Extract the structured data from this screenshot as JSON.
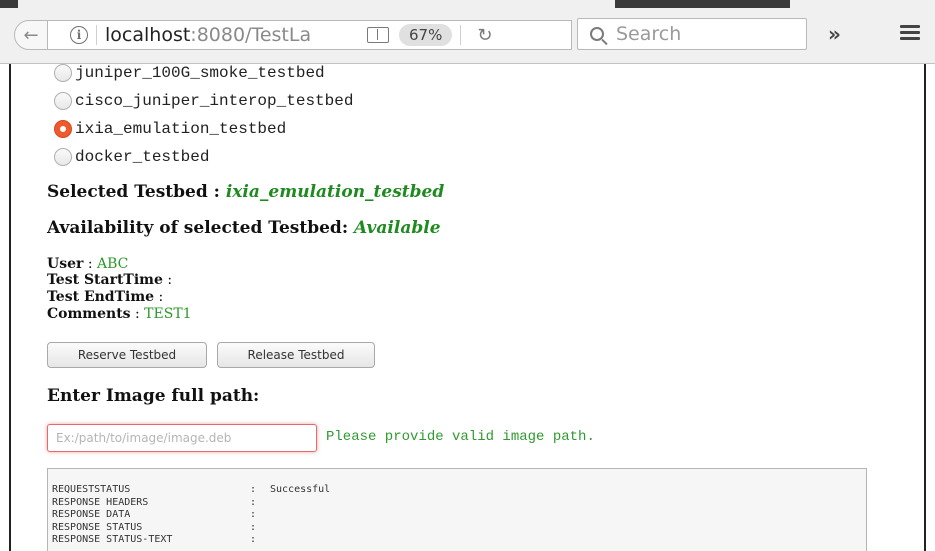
{
  "browser": {
    "url_host": "localhost",
    "url_rest": ":8080/TestLa",
    "zoom": "67%",
    "search_placeholder": "Search",
    "overflow_glyph": "»"
  },
  "testbeds": [
    {
      "label": "juniper_100G_smoke_testbed",
      "checked": false
    },
    {
      "label": "cisco_juniper_interop_testbed",
      "checked": false
    },
    {
      "label": "ixia_emulation_testbed",
      "checked": true
    },
    {
      "label": "docker_testbed",
      "checked": false
    }
  ],
  "selected": {
    "label": "Selected Testbed :",
    "value": "ixia_emulation_testbed"
  },
  "availability": {
    "label": "Availability of selected Testbed:",
    "value": "Available"
  },
  "details": {
    "user_label": "User",
    "user_value": "ABC",
    "start_label": "Test StartTime",
    "end_label": "Test EndTime",
    "comments_label": "Comments",
    "comments_value": "TEST1"
  },
  "buttons": {
    "reserve": "Reserve Testbed",
    "release": "Release Testbed"
  },
  "image_path": {
    "heading": "Enter Image full path:",
    "placeholder": "Ex:/path/to/image/image.deb",
    "hint": "Please provide valid image path."
  },
  "response": [
    {
      "key": "REQUESTSTATUS",
      "value": "Successful"
    },
    {
      "key": "RESPONSE HEADERS",
      "value": ""
    },
    {
      "key": "RESPONSE DATA",
      "value": ""
    },
    {
      "key": "RESPONSE STATUS",
      "value": ""
    },
    {
      "key": "RESPONSE STATUS-TEXT",
      "value": ""
    }
  ]
}
